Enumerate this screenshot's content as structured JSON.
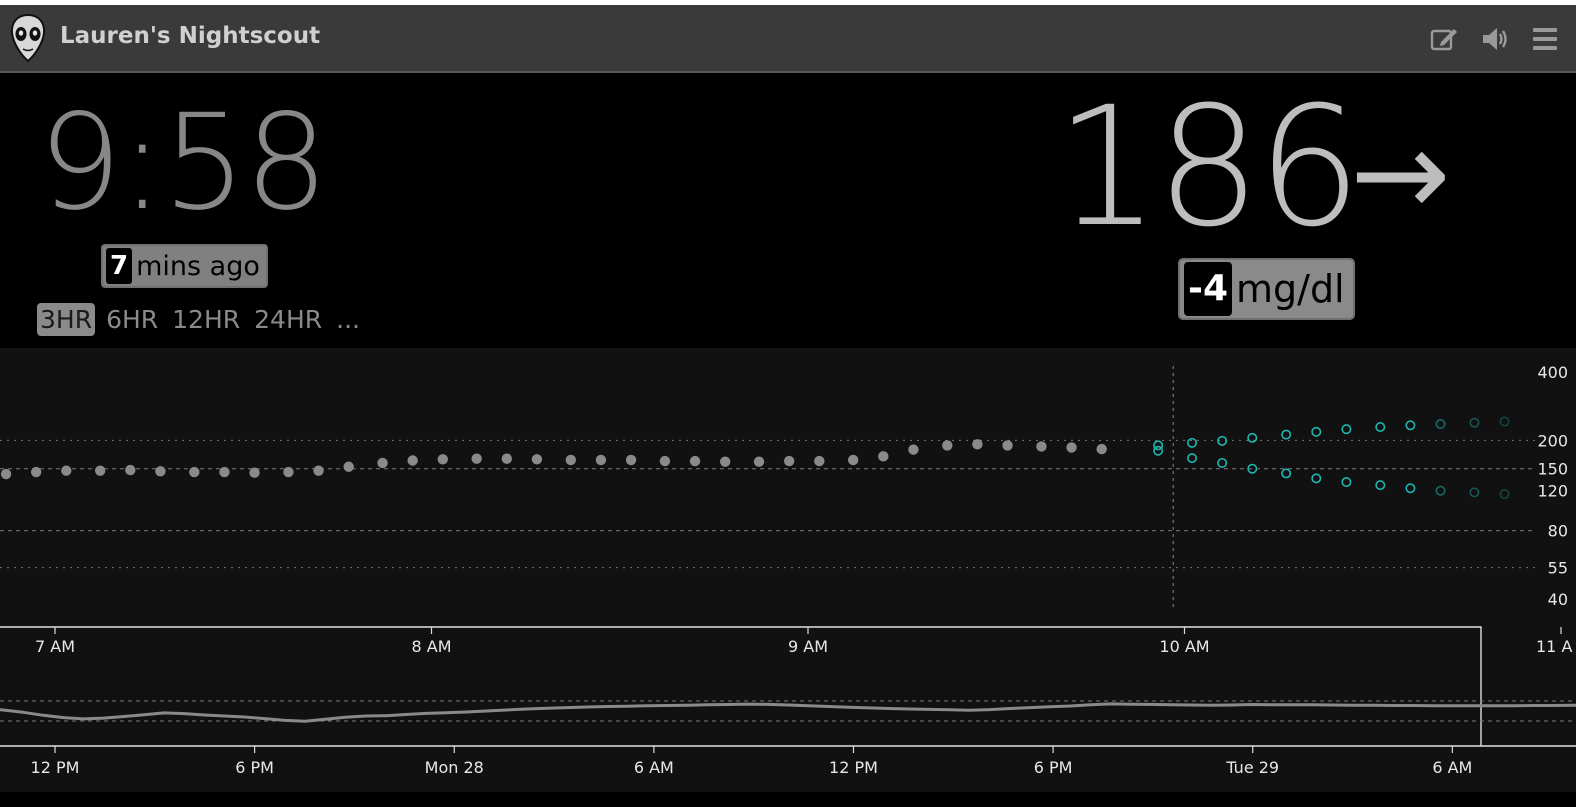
{
  "header": {
    "title": "Lauren's Nightscout",
    "icons": [
      "alien-logo-icon",
      "edit-icon",
      "speaker-icon",
      "menu-icon"
    ]
  },
  "clock": "9:58",
  "last_reading": {
    "minutes": "7",
    "label": "mins ago"
  },
  "ranges": {
    "items": [
      "3HR",
      "6HR",
      "12HR",
      "24HR",
      "..."
    ],
    "selected": "3HR"
  },
  "bg": {
    "value": "186",
    "arrow": "→",
    "delta": "-4",
    "units": "mg/dl"
  },
  "colors": {
    "background": "#000000",
    "chart_background": "#111111",
    "reading_dot": "#8a8a8a",
    "forecast": "#1fb5b0",
    "header": "#3a3a3a"
  },
  "chart_data": [
    {
      "type": "scatter",
      "name": "focus",
      "y_scale": "log",
      "y_ticks": [
        "400",
        "200",
        "150",
        "120",
        "80",
        "55",
        "40"
      ],
      "y_tick_values": [
        400,
        200,
        150,
        120,
        80,
        55,
        40
      ],
      "gridlines": [
        200,
        150,
        80,
        55
      ],
      "x_ticks": [
        "7 AM",
        "8 AM",
        "9 AM",
        "10 AM",
        "11 A"
      ],
      "x_tick_hours": [
        7,
        8,
        9,
        10,
        11
      ],
      "now_hour": 9.97,
      "readings": [
        {
          "t": 6.87,
          "v": 142
        },
        {
          "t": 6.95,
          "v": 145
        },
        {
          "t": 7.03,
          "v": 147
        },
        {
          "t": 7.12,
          "v": 147
        },
        {
          "t": 7.2,
          "v": 148
        },
        {
          "t": 7.28,
          "v": 146
        },
        {
          "t": 7.37,
          "v": 145
        },
        {
          "t": 7.45,
          "v": 145
        },
        {
          "t": 7.53,
          "v": 144
        },
        {
          "t": 7.62,
          "v": 145
        },
        {
          "t": 7.7,
          "v": 147
        },
        {
          "t": 7.78,
          "v": 153
        },
        {
          "t": 7.87,
          "v": 159
        },
        {
          "t": 7.95,
          "v": 163
        },
        {
          "t": 8.03,
          "v": 165
        },
        {
          "t": 8.12,
          "v": 166
        },
        {
          "t": 8.2,
          "v": 166
        },
        {
          "t": 8.28,
          "v": 165
        },
        {
          "t": 8.37,
          "v": 164
        },
        {
          "t": 8.45,
          "v": 164
        },
        {
          "t": 8.53,
          "v": 164
        },
        {
          "t": 8.62,
          "v": 162
        },
        {
          "t": 8.7,
          "v": 162
        },
        {
          "t": 8.78,
          "v": 161
        },
        {
          "t": 8.87,
          "v": 161
        },
        {
          "t": 8.95,
          "v": 162
        },
        {
          "t": 9.03,
          "v": 162
        },
        {
          "t": 9.12,
          "v": 164
        },
        {
          "t": 9.2,
          "v": 170
        },
        {
          "t": 9.28,
          "v": 182
        },
        {
          "t": 9.37,
          "v": 190
        },
        {
          "t": 9.45,
          "v": 192
        },
        {
          "t": 9.53,
          "v": 190
        },
        {
          "t": 9.62,
          "v": 188
        },
        {
          "t": 9.7,
          "v": 186
        },
        {
          "t": 9.78,
          "v": 183
        }
      ],
      "forecast_upper": [
        {
          "t": 9.93,
          "v": 190
        },
        {
          "t": 10.02,
          "v": 195
        },
        {
          "t": 10.1,
          "v": 199
        },
        {
          "t": 10.18,
          "v": 205
        },
        {
          "t": 10.27,
          "v": 212
        },
        {
          "t": 10.35,
          "v": 218
        },
        {
          "t": 10.43,
          "v": 224
        },
        {
          "t": 10.52,
          "v": 229
        },
        {
          "t": 10.6,
          "v": 233
        },
        {
          "t": 10.68,
          "v": 236
        },
        {
          "t": 10.77,
          "v": 239
        },
        {
          "t": 10.85,
          "v": 242
        }
      ],
      "forecast_lower": [
        {
          "t": 9.93,
          "v": 180
        },
        {
          "t": 10.02,
          "v": 167
        },
        {
          "t": 10.1,
          "v": 159
        },
        {
          "t": 10.18,
          "v": 150
        },
        {
          "t": 10.27,
          "v": 143
        },
        {
          "t": 10.35,
          "v": 136
        },
        {
          "t": 10.43,
          "v": 131
        },
        {
          "t": 10.52,
          "v": 127
        },
        {
          "t": 10.6,
          "v": 123
        },
        {
          "t": 10.68,
          "v": 120
        },
        {
          "t": 10.77,
          "v": 118
        },
        {
          "t": 10.85,
          "v": 116
        }
      ]
    },
    {
      "type": "line",
      "name": "context",
      "x_ticks": [
        "12 PM",
        "6 PM",
        "Mon 28",
        "6 AM",
        "12 PM",
        "6 PM",
        "Tue 29",
        "6 AM"
      ],
      "x_tick_hours": [
        12,
        18,
        24,
        30,
        36,
        42,
        48,
        54
      ],
      "brush_hours": [
        -1.67,
        54
      ],
      "reference_lines": [
        180,
        80
      ],
      "y_scale": "log",
      "values": [
        126,
        128,
        132,
        134,
        136,
        140,
        142,
        139,
        136,
        134,
        136,
        138,
        142,
        146,
        150,
        156,
        153,
        147,
        140,
        132,
        125,
        114,
        101,
        92,
        87,
        90,
        96,
        103,
        111,
        108,
        102,
        98,
        94,
        88,
        82,
        79,
        86,
        93,
        98,
        99,
        104,
        109,
        112,
        115,
        120,
        125,
        130,
        134,
        138,
        141,
        144,
        146,
        148,
        150,
        152,
        154,
        156,
        159,
        157,
        153,
        149,
        144,
        140,
        136,
        133,
        130,
        128,
        126,
        124,
        127,
        133,
        138,
        143,
        147,
        155,
        160,
        158,
        157,
        155,
        153,
        151,
        153,
        156,
        155,
        155,
        154,
        153,
        152,
        151,
        150,
        150,
        149,
        148,
        148,
        149,
        149,
        150,
        150,
        151,
        151,
        151,
        152,
        152,
        152,
        153,
        153,
        153
      ]
    }
  ]
}
